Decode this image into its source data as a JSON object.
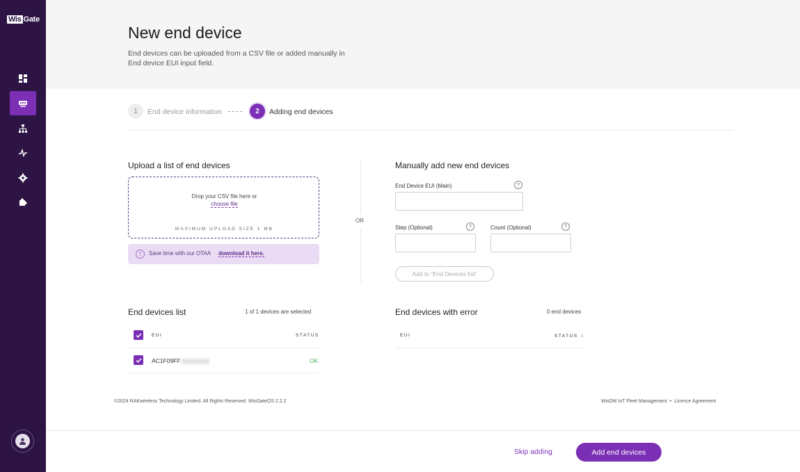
{
  "logo": {
    "wis": "Wis",
    "gate": "Gate"
  },
  "sidebar": {
    "items": [
      {
        "icon": "dashboard-icon",
        "active": false
      },
      {
        "icon": "devices-icon",
        "active": true
      },
      {
        "icon": "network-icon",
        "active": false
      },
      {
        "icon": "activity-icon",
        "active": false
      },
      {
        "icon": "gear-icon",
        "active": false
      },
      {
        "icon": "puzzle-icon",
        "active": false
      }
    ]
  },
  "header": {
    "title": "New end device",
    "description": "End devices can be uploaded from a CSV file or added manually in End device EUI input field."
  },
  "stepper": {
    "steps": [
      {
        "number": "1",
        "label": "End device information"
      },
      {
        "number": "2",
        "label": "Adding end devices"
      }
    ]
  },
  "upload": {
    "title": "Upload a list of end devices",
    "drop_text": "Drop your CSV file here or",
    "choose_file": "choose file",
    "max_size": "MAXIMUM UPLOAD SIZE 1 MB",
    "otaa_text": "Save time with our OTAA",
    "otaa_link": "download it here."
  },
  "or_label": "OR",
  "manual": {
    "title": "Manually add new end devices",
    "eui_label": "End Device EUI (Main)",
    "step_label": "Step (Optional)",
    "count_label": "Count (Optional)",
    "help": "?",
    "add_button": "Add to “End Devices list”"
  },
  "devices_list": {
    "title": "End devices list",
    "count": "1 of 1 devices are selected",
    "col_eui": "EUI",
    "col_status": "STATUS",
    "rows": [
      {
        "eui": "AC1F09FF",
        "status": "OK"
      }
    ]
  },
  "error_list": {
    "title": "End devices with error",
    "count": "0 end devices",
    "col_eui": "EUI",
    "col_status": "STATUS"
  },
  "footer": {
    "copyright": "©2024 RAKwireless Technology Limited. All Rights Reserved. WisGateOS 2.2.2",
    "link1": "WisDM IoT Fleet Management",
    "separator": "•",
    "link2": "Licence Agreement"
  },
  "actions": {
    "skip": "Skip adding",
    "add": "Add end devices"
  },
  "colors": {
    "accent": "#7b2fb5",
    "sidebar": "#2d1445",
    "ok": "#4caf50"
  }
}
